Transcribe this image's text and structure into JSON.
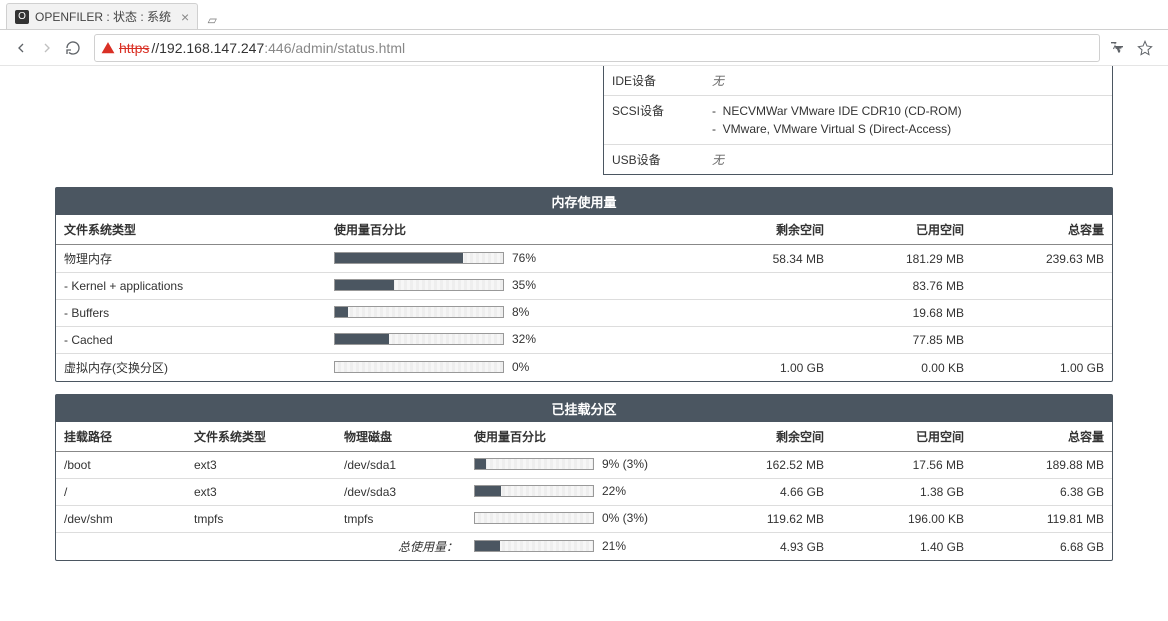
{
  "browser": {
    "tab_title": "OPENFILER : 状态 : 系统",
    "url_scheme": "https",
    "url_host": "//192.168.147.247",
    "url_path": ":446/admin/status.html"
  },
  "devices": {
    "partial_rows": [
      {
        "label": "IDE设备",
        "value_type": "none",
        "value": "无"
      },
      {
        "label": "SCSI设备",
        "value_type": "list",
        "items": [
          "NECVMWar VMware IDE CDR10 (CD-ROM)",
          "VMware, VMware Virtual S (Direct-Access)"
        ]
      },
      {
        "label": "USB设备",
        "value_type": "none",
        "value": "无"
      }
    ]
  },
  "memory": {
    "title": "内存使用量",
    "headers": [
      "文件系统类型",
      "使用量百分比",
      "剩余空间",
      "已用空间",
      "总容量"
    ],
    "rows": [
      {
        "name": "物理内存",
        "pct": 76,
        "pct_label": "76%",
        "free": "58.34 MB",
        "used": "181.29 MB",
        "total": "239.63 MB"
      },
      {
        "name": "- Kernel + applications",
        "pct": 35,
        "pct_label": "35%",
        "free": "",
        "used": "83.76 MB",
        "total": ""
      },
      {
        "name": "- Buffers",
        "pct": 8,
        "pct_label": "8%",
        "free": "",
        "used": "19.68 MB",
        "total": ""
      },
      {
        "name": "- Cached",
        "pct": 32,
        "pct_label": "32%",
        "free": "",
        "used": "77.85 MB",
        "total": ""
      },
      {
        "name": "虚拟内存(交换分区)",
        "pct": 0,
        "pct_label": "0%",
        "free": "1.00 GB",
        "used": "0.00 KB",
        "total": "1.00 GB"
      }
    ]
  },
  "mounts": {
    "title": "已挂载分区",
    "headers": [
      "挂载路径",
      "文件系统类型",
      "物理磁盘",
      "使用量百分比",
      "剩余空间",
      "已用空间",
      "总容量"
    ],
    "rows": [
      {
        "mount": "/boot",
        "fstype": "ext3",
        "disk": "/dev/sda1",
        "pct": 9,
        "pct_label": "9% (3%)",
        "free": "162.52 MB",
        "used": "17.56 MB",
        "total": "189.88 MB"
      },
      {
        "mount": "/",
        "fstype": "ext3",
        "disk": "/dev/sda3",
        "pct": 22,
        "pct_label": "22%",
        "free": "4.66 GB",
        "used": "1.38 GB",
        "total": "6.38 GB"
      },
      {
        "mount": "/dev/shm",
        "fstype": "tmpfs",
        "disk": "tmpfs",
        "pct": 0,
        "pct_label": "0% (3%)",
        "free": "119.62 MB",
        "used": "196.00 KB",
        "total": "119.81 MB"
      }
    ],
    "totals_label": "总使用量：",
    "totals": {
      "pct": 21,
      "pct_label": "21%",
      "free": "4.93 GB",
      "used": "1.40 GB",
      "total": "6.68 GB"
    }
  }
}
